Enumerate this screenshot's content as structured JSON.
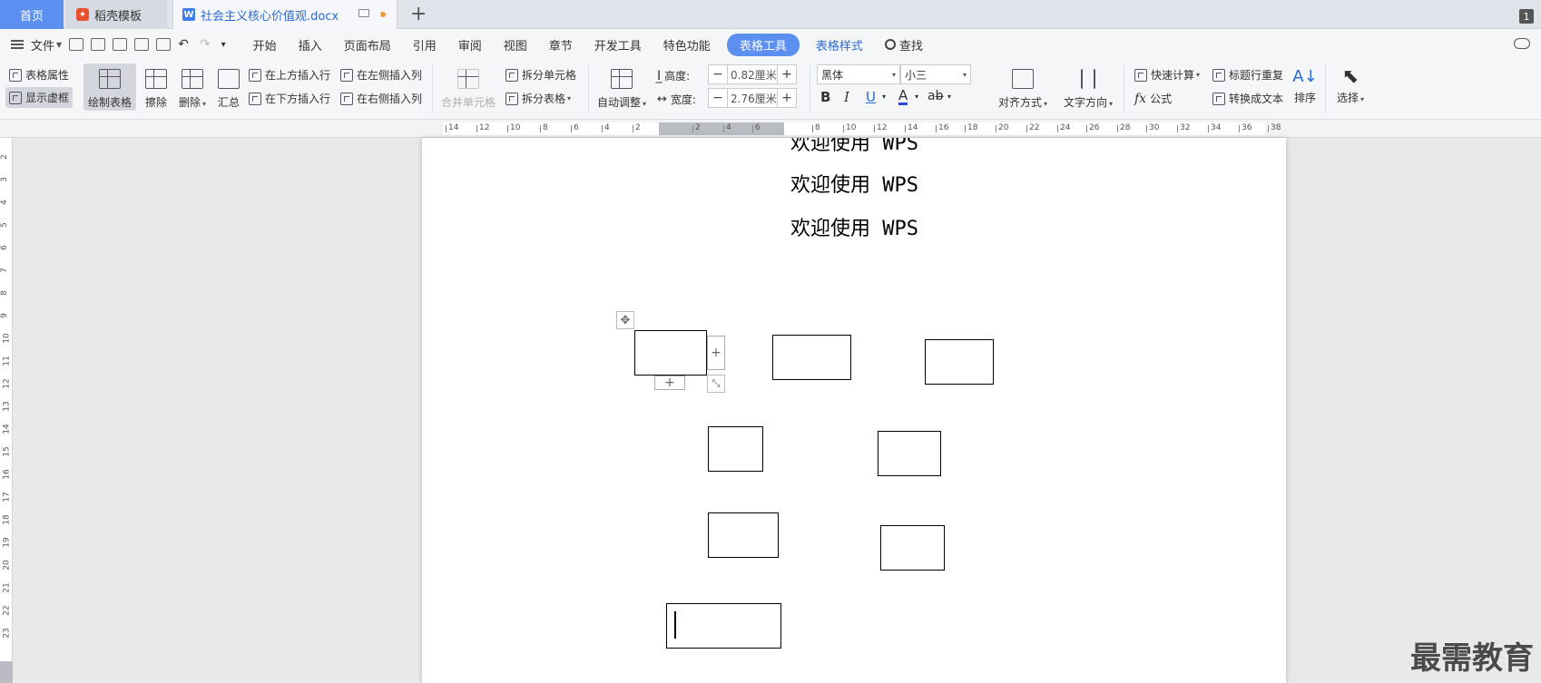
{
  "tabs": {
    "home": "首页",
    "template": "稻壳模板",
    "doc": "社会主义核心价值观.docx",
    "window_count": "1"
  },
  "menu": {
    "file": "文件",
    "items": [
      "开始",
      "插入",
      "页面布局",
      "引用",
      "审阅",
      "视图",
      "章节",
      "开发工具",
      "特色功能"
    ],
    "active": "表格工具",
    "style": "表格样式",
    "search": "查找"
  },
  "ribbon": {
    "table_props": "表格属性",
    "show_grid": "显示虚框",
    "draw_table": "绘制表格",
    "erase": "擦除",
    "delete": "删除",
    "summary": "汇总",
    "insert_row_above": "在上方插入行",
    "insert_row_below": "在下方插入行",
    "insert_col_left": "在左侧插入列",
    "insert_col_right": "在右侧插入列",
    "merge_cells": "合并单元格",
    "split_cells": "拆分单元格",
    "split_table": "拆分表格",
    "auto_fit": "自动调整",
    "height_label": "高度:",
    "height_value": "0.82厘米",
    "width_label": "宽度:",
    "width_value": "2.76厘米",
    "font_name": "黑体",
    "font_size": "小三",
    "bold": "B",
    "italic": "I",
    "underline": "U",
    "font_color": "A",
    "align": "对齐方式",
    "text_direction": "文字方向",
    "quick_calc": "快速计算",
    "formula": "公式",
    "repeat_header": "标题行重复",
    "to_text": "转换成文本",
    "sort": "排序",
    "select": "选择"
  },
  "ruler": {
    "h_ticks": [
      "14",
      "12",
      "10",
      "8",
      "6",
      "4",
      "2",
      "2",
      "4",
      "6",
      "8",
      "10",
      "12",
      "14",
      "16",
      "18",
      "20",
      "22",
      "24",
      "26",
      "28",
      "30",
      "32",
      "34",
      "36",
      "38"
    ],
    "v_ticks": [
      "2",
      "3",
      "4",
      "5",
      "6",
      "7",
      "8",
      "9",
      "10",
      "11",
      "12",
      "13",
      "14",
      "15",
      "16",
      "17",
      "18",
      "19",
      "20",
      "21",
      "22",
      "23"
    ]
  },
  "document": {
    "lines": [
      "欢迎使用 WPS",
      "欢迎使用 WPS",
      "欢迎使用 WPS"
    ]
  },
  "watermark": "最需教育"
}
